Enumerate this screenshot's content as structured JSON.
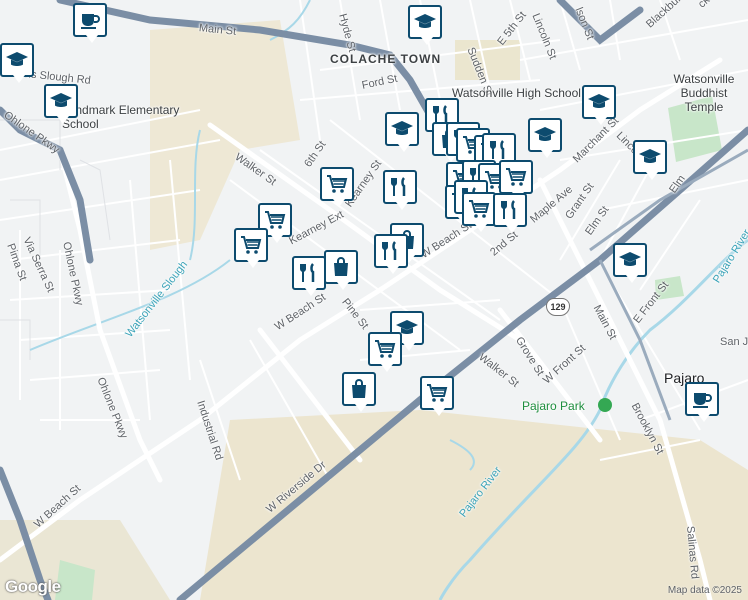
{
  "map": {
    "attribution": "Map data ©2025",
    "logo": "Google",
    "highway_shield": "129"
  },
  "labels": {
    "main_st_top": "Main St",
    "hyde_st": "Hyde St",
    "colache_town": "COLACHE TOWN",
    "sudden_st": "Sudden St",
    "e5th_st": "E 5th St",
    "lincoln_st_top": "Lincoln St",
    "olson_st": "lson St",
    "blackburn_st": "Blackburn St",
    "ck_st": "ck St",
    "slough_rd": "ns Slough Rd",
    "watsonville_high": "Watsonville High School",
    "buddhist_temple": "Watsonville Buddhist Temple",
    "ford_st": "Ford St",
    "landmark_school": "Landmark Elementary School",
    "ohlone_pkwy_top": "Ohlone Pkwy",
    "walker_st_top": "Walker St",
    "sixth_st": "6th St",
    "kearney_st": "Kearney St",
    "marchant_st": "Marchant St",
    "lincoln_st_right": "Lincoln",
    "elm_right": "Elm",
    "grant_st": "Grant St",
    "elm_st": "Elm St",
    "maple_ave": "Maple Ave",
    "second_st": "2nd St",
    "w_beach_st_mid": "W Beach St",
    "kearney_ext": "Kearney Ext",
    "w_beach_st_left": "W Beach St",
    "via_serra": "Via Serra St",
    "pima_st": "Pima St",
    "ohlone_pkwy_left": "Ohlone Pkwy",
    "ohlone_pkwy_bottom": "Ohlone Pkwy",
    "watsonville_slough": "Watsonville Slough",
    "pine_st": "Pine St",
    "pajaro_river_top": "Pajaro River",
    "e_front_st": "E Front St",
    "main_st_right": "Main St",
    "san_j": "San J",
    "pajaro": "Pajaro",
    "grove_st": "Grove St",
    "walker_st_bottom": "Walker St",
    "w_front_st": "W Front St",
    "pajaro_park": "Pajaro Park",
    "brooklyn_st": "Brooklyn St",
    "industrial_rd": "Industrial Rd",
    "w_beach_st_bottom": "W Beach St",
    "w_riverside_dr": "W Riverside Dr",
    "pajaro_river_bottom": "Pajaro River",
    "salinas_rd": "Salinas Rd"
  },
  "icons": {
    "cafe": "coffee-cup-icon",
    "school": "graduation-cap-icon",
    "shopping": "shopping-bag-icon",
    "grocery": "shopping-cart-icon",
    "restaurant": "fork-knife-icon"
  }
}
